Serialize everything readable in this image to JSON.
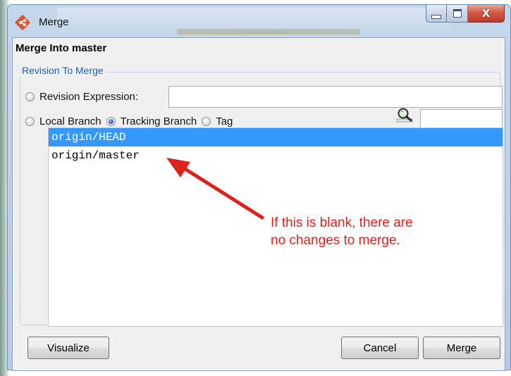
{
  "window": {
    "title": "Merge",
    "controls": {
      "minimize_icon": "minimize-icon",
      "maximize_icon": "maximize-icon",
      "close_icon": "close-icon",
      "close_glyph": "X"
    },
    "app_icon": "git-diamond-icon"
  },
  "dialog": {
    "header": "Merge Into master",
    "group_title": "Revision To Merge",
    "revision_expression": {
      "label": "Revision Expression:",
      "value": "",
      "selected": false
    },
    "branch_types": [
      {
        "label": "Local Branch",
        "selected": false
      },
      {
        "label": "Tracking Branch",
        "selected": true
      },
      {
        "label": "Tag",
        "selected": false
      }
    ],
    "filter": {
      "icon": "search-icon",
      "value": ""
    },
    "branches": [
      {
        "name": "origin/HEAD",
        "selected": true
      },
      {
        "name": "origin/master",
        "selected": false
      }
    ],
    "buttons": {
      "visualize": "Visualize",
      "cancel": "Cancel",
      "merge": "Merge"
    }
  },
  "annotation": {
    "line1": "If this is blank, there are",
    "line2": "no changes to merge.",
    "color": "#e0201b"
  },
  "colors": {
    "selection": "#3399ff",
    "group_title": "#1e5fb0",
    "window_frame": "#b7cbe3"
  }
}
